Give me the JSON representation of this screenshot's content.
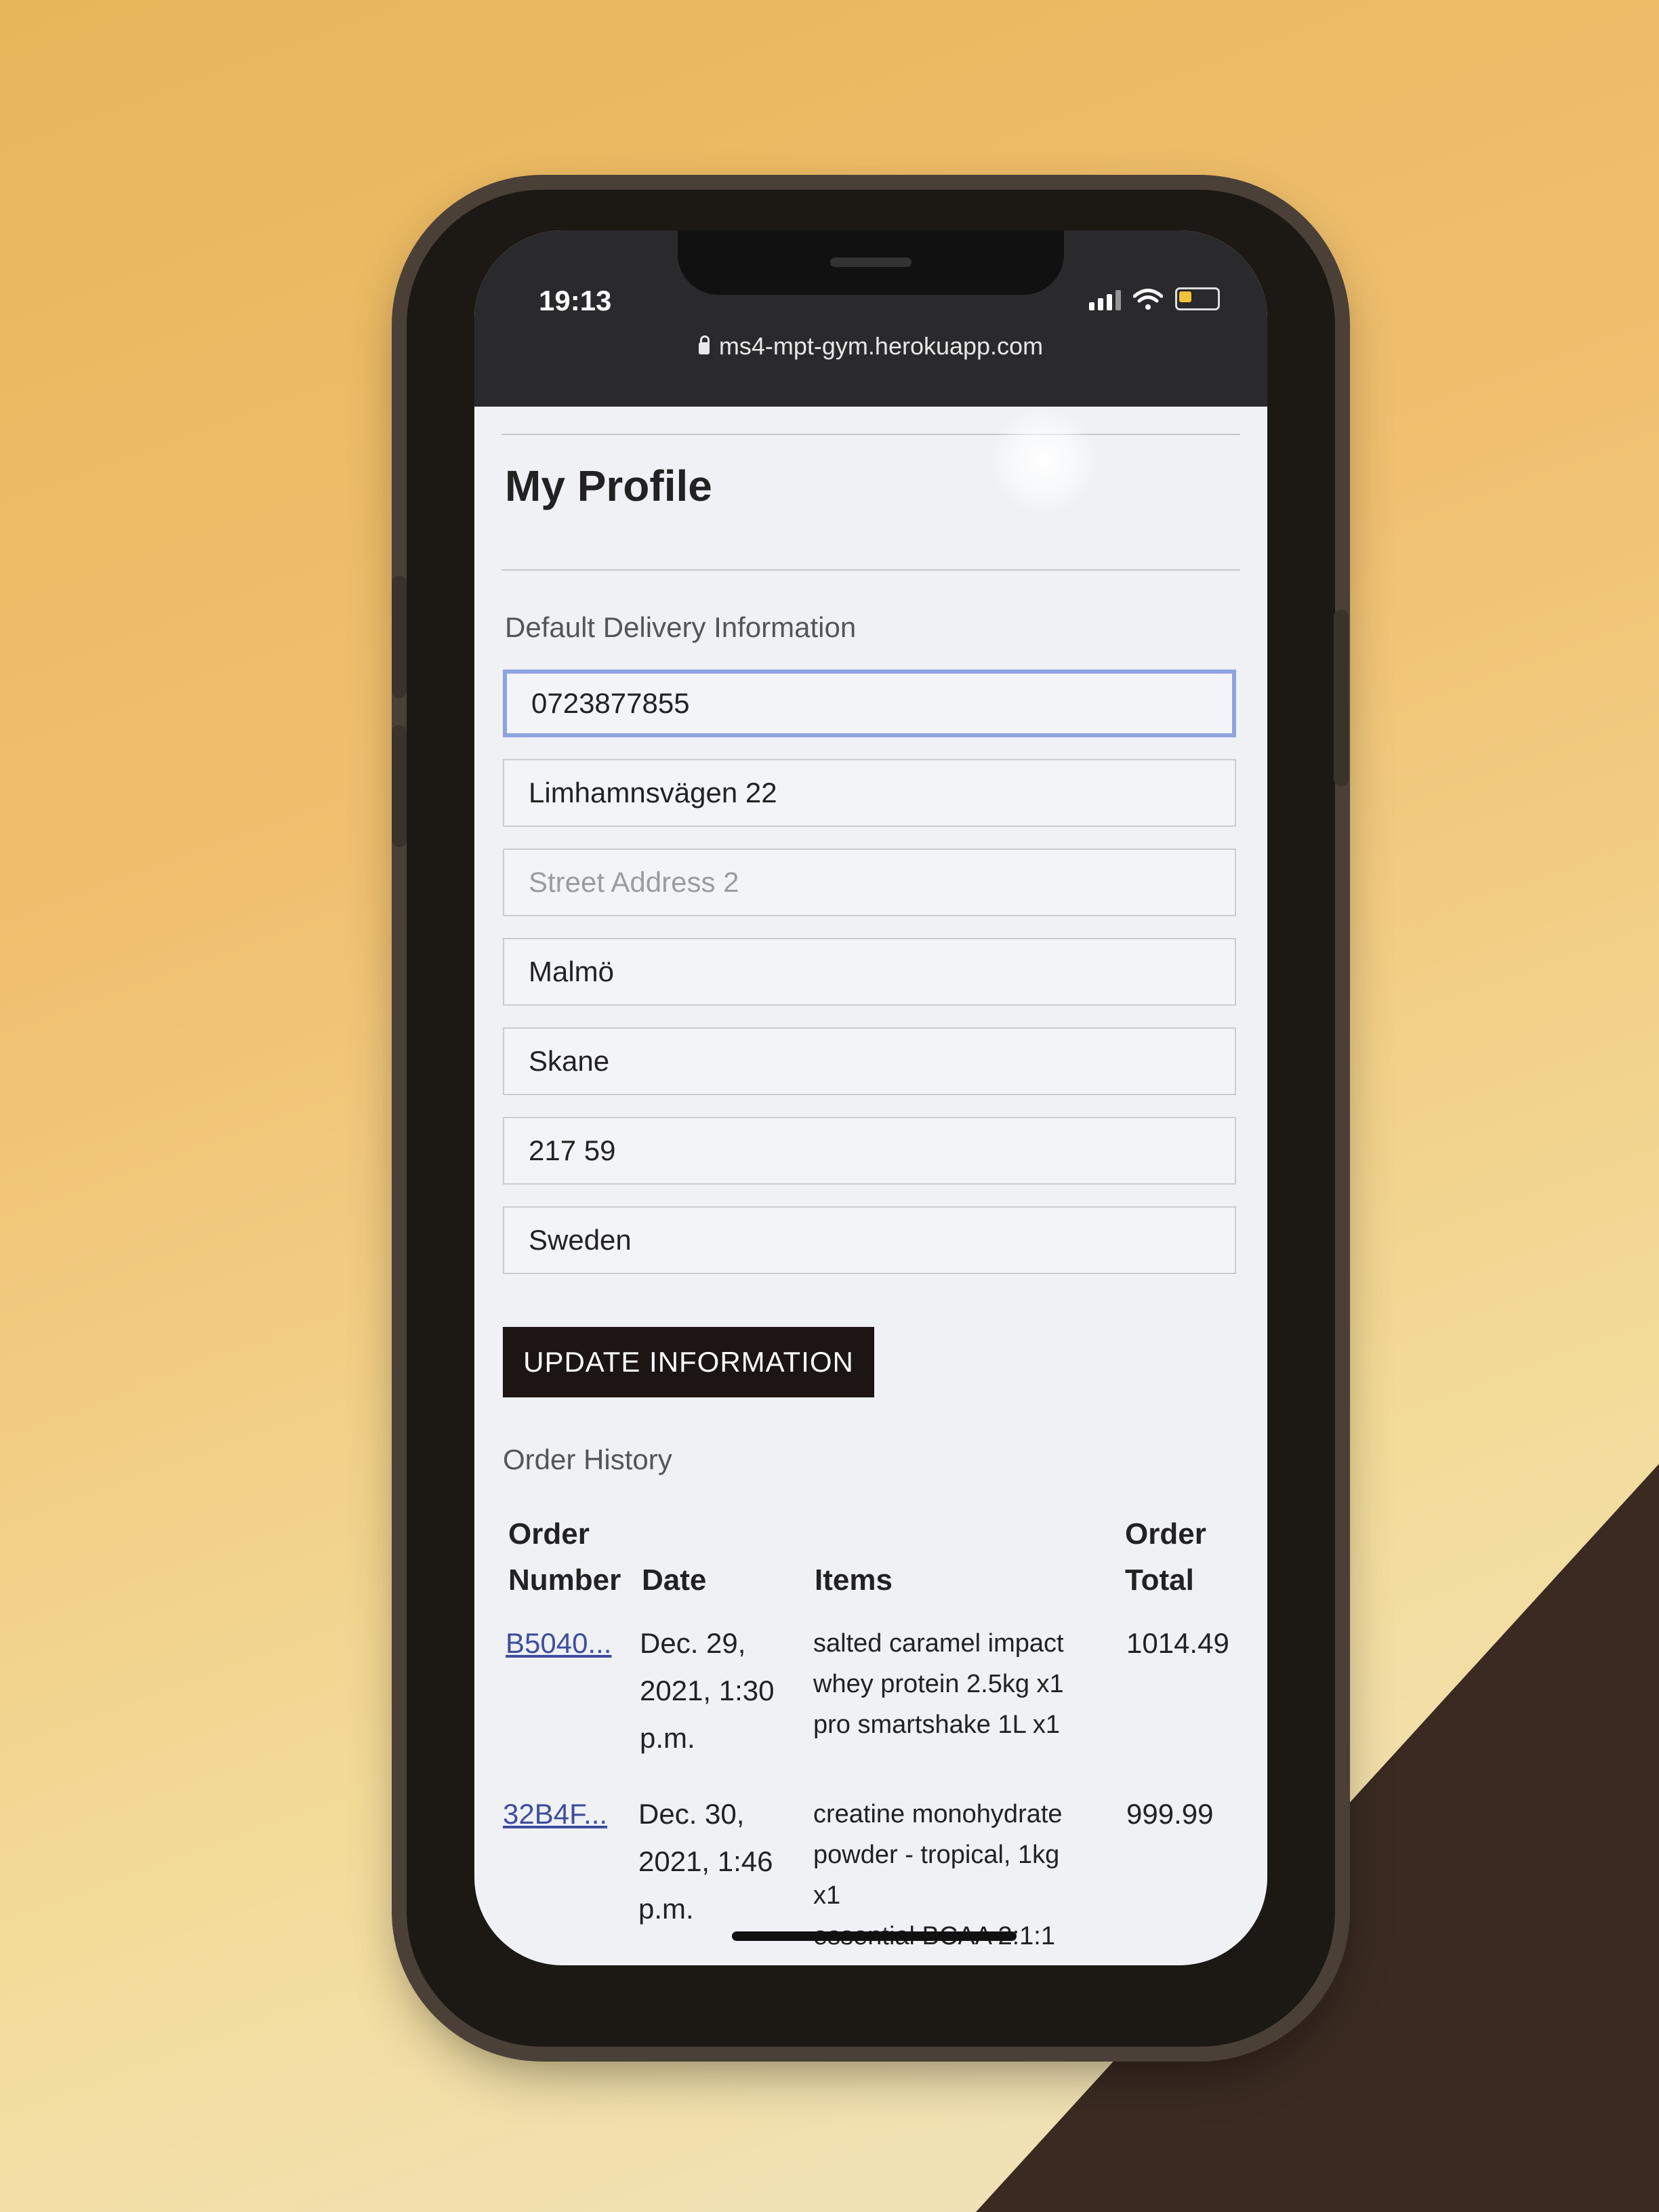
{
  "status_bar": {
    "time": "19:13",
    "url": "ms4-mpt-gym.herokuapp.com"
  },
  "page": {
    "title": "My Profile",
    "section_delivery": "Default Delivery Information"
  },
  "form": {
    "phone": "0723877855",
    "street1": "Limhamnsvägen 22",
    "street2_placeholder": "Street Address 2",
    "town": "Malmö",
    "county": "Skane",
    "postcode": "217 59",
    "country": "Sweden",
    "update_label": "UPDATE INFORMATION"
  },
  "orders": {
    "title": "Order History",
    "headers": {
      "number_1": "Order",
      "number_2": "Number",
      "date": "Date",
      "items": "Items",
      "total_1": "Order",
      "total_2": "Total"
    },
    "rows": [
      {
        "number": "B5040...",
        "date_1": "Dec. 29,",
        "date_2": "2021, 1:30",
        "date_3": "p.m.",
        "items_1": "salted caramel impact",
        "items_2": "whey protein 2.5kg x1",
        "items_3": "pro smartshake 1L x1",
        "items_4": "",
        "total": "1014.49"
      },
      {
        "number": "32B4F...",
        "date_1": "Dec. 30,",
        "date_2": "2021, 1:46",
        "date_3": "p.m.",
        "items_1": "creatine monohydrate",
        "items_2": "powder - tropical, 1kg",
        "items_3": "x1",
        "items_4": "essential BCAA 2:1:1",
        "total": "999.99"
      }
    ]
  }
}
